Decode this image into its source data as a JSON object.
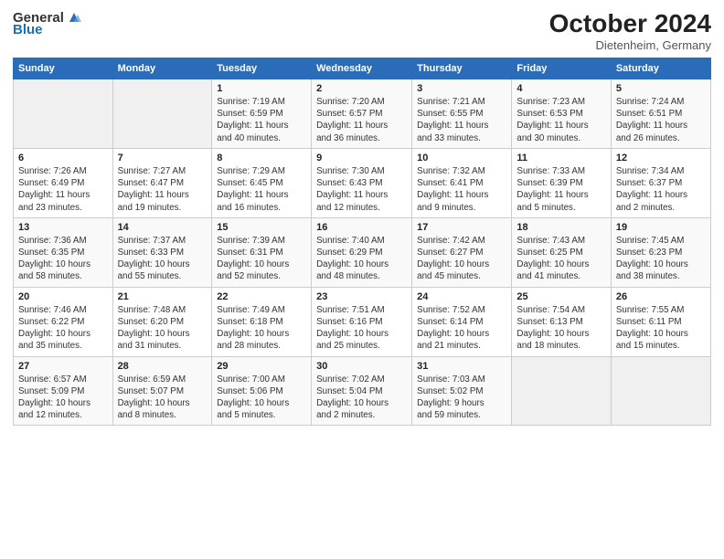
{
  "header": {
    "logo_general": "General",
    "logo_blue": "Blue",
    "month": "October 2024",
    "location": "Dietenheim, Germany"
  },
  "weekdays": [
    "Sunday",
    "Monday",
    "Tuesday",
    "Wednesday",
    "Thursday",
    "Friday",
    "Saturday"
  ],
  "weeks": [
    [
      {
        "day": "",
        "info": ""
      },
      {
        "day": "",
        "info": ""
      },
      {
        "day": "1",
        "info": "Sunrise: 7:19 AM\nSunset: 6:59 PM\nDaylight: 11 hours\nand 40 minutes."
      },
      {
        "day": "2",
        "info": "Sunrise: 7:20 AM\nSunset: 6:57 PM\nDaylight: 11 hours\nand 36 minutes."
      },
      {
        "day": "3",
        "info": "Sunrise: 7:21 AM\nSunset: 6:55 PM\nDaylight: 11 hours\nand 33 minutes."
      },
      {
        "day": "4",
        "info": "Sunrise: 7:23 AM\nSunset: 6:53 PM\nDaylight: 11 hours\nand 30 minutes."
      },
      {
        "day": "5",
        "info": "Sunrise: 7:24 AM\nSunset: 6:51 PM\nDaylight: 11 hours\nand 26 minutes."
      }
    ],
    [
      {
        "day": "6",
        "info": "Sunrise: 7:26 AM\nSunset: 6:49 PM\nDaylight: 11 hours\nand 23 minutes."
      },
      {
        "day": "7",
        "info": "Sunrise: 7:27 AM\nSunset: 6:47 PM\nDaylight: 11 hours\nand 19 minutes."
      },
      {
        "day": "8",
        "info": "Sunrise: 7:29 AM\nSunset: 6:45 PM\nDaylight: 11 hours\nand 16 minutes."
      },
      {
        "day": "9",
        "info": "Sunrise: 7:30 AM\nSunset: 6:43 PM\nDaylight: 11 hours\nand 12 minutes."
      },
      {
        "day": "10",
        "info": "Sunrise: 7:32 AM\nSunset: 6:41 PM\nDaylight: 11 hours\nand 9 minutes."
      },
      {
        "day": "11",
        "info": "Sunrise: 7:33 AM\nSunset: 6:39 PM\nDaylight: 11 hours\nand 5 minutes."
      },
      {
        "day": "12",
        "info": "Sunrise: 7:34 AM\nSunset: 6:37 PM\nDaylight: 11 hours\nand 2 minutes."
      }
    ],
    [
      {
        "day": "13",
        "info": "Sunrise: 7:36 AM\nSunset: 6:35 PM\nDaylight: 10 hours\nand 58 minutes."
      },
      {
        "day": "14",
        "info": "Sunrise: 7:37 AM\nSunset: 6:33 PM\nDaylight: 10 hours\nand 55 minutes."
      },
      {
        "day": "15",
        "info": "Sunrise: 7:39 AM\nSunset: 6:31 PM\nDaylight: 10 hours\nand 52 minutes."
      },
      {
        "day": "16",
        "info": "Sunrise: 7:40 AM\nSunset: 6:29 PM\nDaylight: 10 hours\nand 48 minutes."
      },
      {
        "day": "17",
        "info": "Sunrise: 7:42 AM\nSunset: 6:27 PM\nDaylight: 10 hours\nand 45 minutes."
      },
      {
        "day": "18",
        "info": "Sunrise: 7:43 AM\nSunset: 6:25 PM\nDaylight: 10 hours\nand 41 minutes."
      },
      {
        "day": "19",
        "info": "Sunrise: 7:45 AM\nSunset: 6:23 PM\nDaylight: 10 hours\nand 38 minutes."
      }
    ],
    [
      {
        "day": "20",
        "info": "Sunrise: 7:46 AM\nSunset: 6:22 PM\nDaylight: 10 hours\nand 35 minutes."
      },
      {
        "day": "21",
        "info": "Sunrise: 7:48 AM\nSunset: 6:20 PM\nDaylight: 10 hours\nand 31 minutes."
      },
      {
        "day": "22",
        "info": "Sunrise: 7:49 AM\nSunset: 6:18 PM\nDaylight: 10 hours\nand 28 minutes."
      },
      {
        "day": "23",
        "info": "Sunrise: 7:51 AM\nSunset: 6:16 PM\nDaylight: 10 hours\nand 25 minutes."
      },
      {
        "day": "24",
        "info": "Sunrise: 7:52 AM\nSunset: 6:14 PM\nDaylight: 10 hours\nand 21 minutes."
      },
      {
        "day": "25",
        "info": "Sunrise: 7:54 AM\nSunset: 6:13 PM\nDaylight: 10 hours\nand 18 minutes."
      },
      {
        "day": "26",
        "info": "Sunrise: 7:55 AM\nSunset: 6:11 PM\nDaylight: 10 hours\nand 15 minutes."
      }
    ],
    [
      {
        "day": "27",
        "info": "Sunrise: 6:57 AM\nSunset: 5:09 PM\nDaylight: 10 hours\nand 12 minutes."
      },
      {
        "day": "28",
        "info": "Sunrise: 6:59 AM\nSunset: 5:07 PM\nDaylight: 10 hours\nand 8 minutes."
      },
      {
        "day": "29",
        "info": "Sunrise: 7:00 AM\nSunset: 5:06 PM\nDaylight: 10 hours\nand 5 minutes."
      },
      {
        "day": "30",
        "info": "Sunrise: 7:02 AM\nSunset: 5:04 PM\nDaylight: 10 hours\nand 2 minutes."
      },
      {
        "day": "31",
        "info": "Sunrise: 7:03 AM\nSunset: 5:02 PM\nDaylight: 9 hours\nand 59 minutes."
      },
      {
        "day": "",
        "info": ""
      },
      {
        "day": "",
        "info": ""
      }
    ]
  ]
}
